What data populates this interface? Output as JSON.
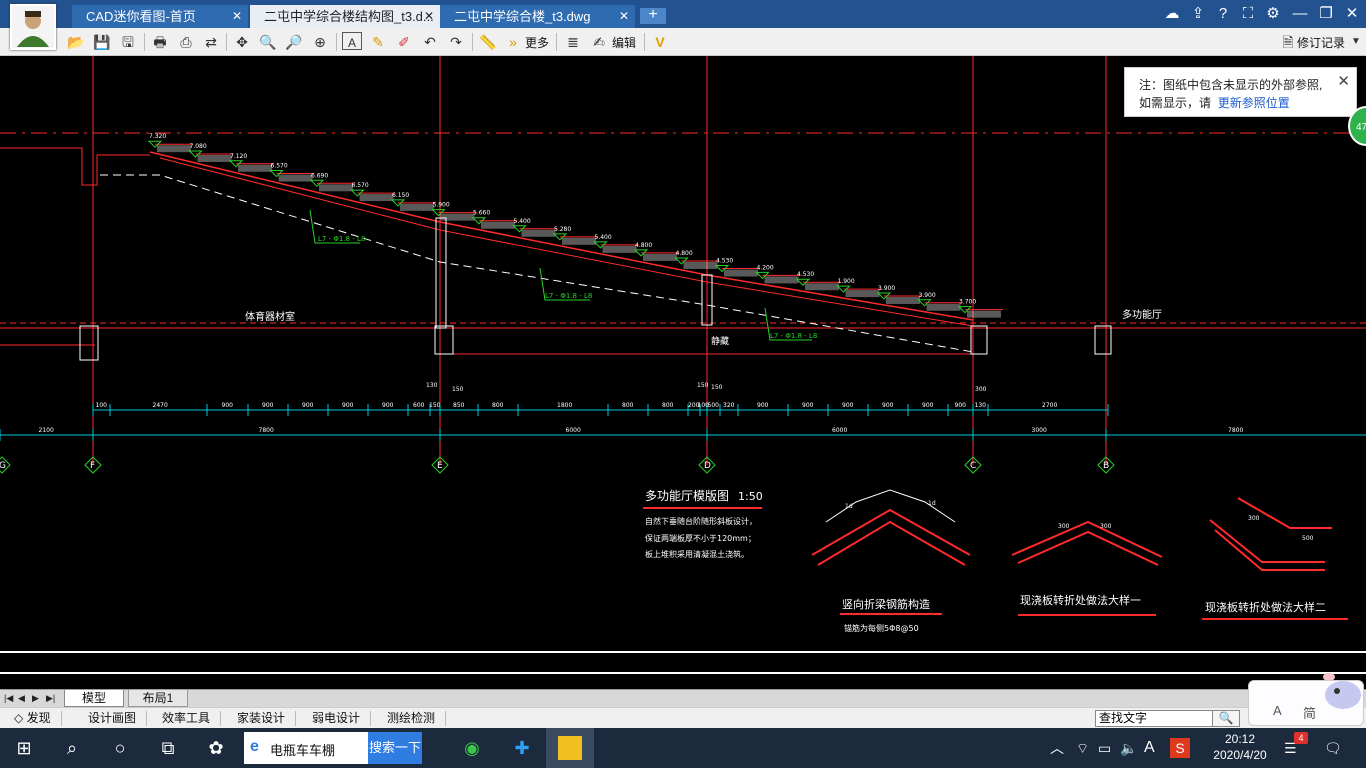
{
  "tabs": [
    {
      "label": "CAD迷你看图-首页"
    },
    {
      "label": "二屯中学综合楼结构图_t3.d..."
    },
    {
      "label": "二屯中学综合楼_t3.dwg"
    }
  ],
  "toolbar": {
    "more_label": "更多",
    "edit_label": "编辑",
    "revision_label": "修订记录"
  },
  "notice": {
    "text1": "注：图纸中包含未显示的外部参照,",
    "text2": "如需显示，请",
    "link": "更新参照位置",
    "badge": "47"
  },
  "drawing": {
    "labels": {
      "gym_room": "体育器材室",
      "multi_hall": "多功能厅",
      "mid_room": "静藏",
      "slope1": "L7 - Φ1.8 - L8",
      "slope2": "L7 - Φ1.8 - L8",
      "slope3": "L7 - Φ1.8 - L8"
    },
    "elevations": [
      "7.320",
      "7.080",
      "7.120",
      "6.570",
      "6.690",
      "6.570",
      "6.150",
      "5.900",
      "5.660",
      "5.400",
      "5.280",
      "5.400",
      "4.800",
      "4.800",
      "4.530",
      "4.200",
      "4.530",
      "1.900",
      "3.900",
      "3.900",
      "3.700"
    ],
    "dims_top": [
      "100",
      "2470",
      "900",
      "900",
      "900",
      "900",
      "900",
      "600",
      "150",
      "850",
      "800",
      "1800",
      "800",
      "800",
      "200",
      "100",
      "500",
      "320",
      "900",
      "900",
      "900",
      "900",
      "900",
      "900",
      "130",
      "2700"
    ],
    "dims_small": [
      "130",
      "150",
      "150",
      "150",
      "300"
    ],
    "dims_bottom": [
      "2100",
      "7800",
      "6000",
      "6000",
      "3000",
      "7800"
    ],
    "axes": [
      "G",
      "F",
      "E",
      "D",
      "C",
      "B"
    ],
    "detail_title": "多功能厅模版图",
    "detail_scale": "1:50",
    "detail_notes": [
      "自然下垂随台阶随形斜板设计，",
      "保证两端板厚不小于120mm；",
      "板上堆积采用清凝混土浇筑。"
    ],
    "sketch1_title": "竖向折梁钢筋构造",
    "sketch1_note": "锚筋为每侧5Φ8@50",
    "sketch2_title": "现浇板转折处做法大样一",
    "sketch3_title": "现浇板转折处做法大样二",
    "sketch_dims": [
      "1d",
      "1d",
      "300",
      "300",
      "300",
      "500"
    ]
  },
  "layout_tabs": [
    {
      "label": "模型"
    },
    {
      "label": "布局1"
    }
  ],
  "menu": [
    {
      "label": "发现"
    },
    {
      "label": "设计画图"
    },
    {
      "label": "效率工具"
    },
    {
      "label": "家装设计"
    },
    {
      "label": "弱电设计"
    },
    {
      "label": "测绘检测"
    }
  ],
  "find": {
    "placeholder": "查找文字"
  },
  "ime": {
    "a": "A",
    "mode": "简"
  },
  "taskbar": {
    "search_text": "电瓶车车棚",
    "search_btn": "搜索一下",
    "time": "20:12",
    "date": "2020/4/20",
    "notif_count": "4",
    "ime_letter": "A"
  },
  "colors": {
    "titlebar": "#22528f",
    "cad_red": "#ff2a2a",
    "cad_green": "#29d129",
    "cad_cyan": "#00c8d8",
    "cad_white": "#ffffff"
  }
}
